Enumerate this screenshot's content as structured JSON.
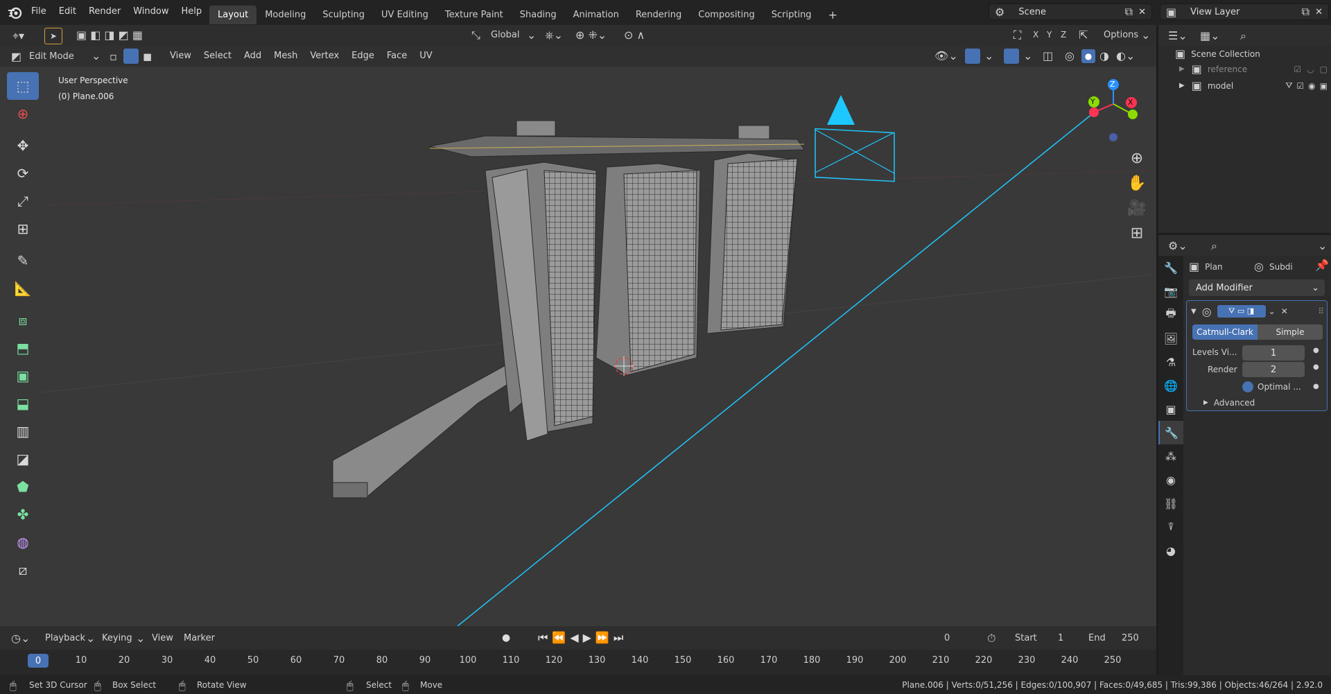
{
  "menu": [
    "File",
    "Edit",
    "Render",
    "Window",
    "Help"
  ],
  "workspaces": [
    "Layout",
    "Modeling",
    "Sculpting",
    "UV Editing",
    "Texture Paint",
    "Shading",
    "Animation",
    "Rendering",
    "Compositing",
    "Scripting"
  ],
  "active_workspace": "Layout",
  "scene": {
    "name": "Scene",
    "view_layer": "View Layer"
  },
  "viewport_header": {
    "transform_orientation": "Global",
    "axis_x": "X",
    "axis_y": "Y",
    "axis_z": "Z",
    "options": "Options"
  },
  "editor_header": {
    "mode": "Edit Mode",
    "menus": [
      "View",
      "Select",
      "Add",
      "Mesh",
      "Vertex",
      "Edge",
      "Face",
      "UV"
    ]
  },
  "overlay_text": {
    "line1": "User Perspective",
    "line2": "(0) Plane.006"
  },
  "gizmo": {
    "z": "Z",
    "y": "Y",
    "x": "X"
  },
  "colors": {
    "accent": "#4772b3",
    "viewport_bg": "#393939",
    "camera": "#1ec8ff",
    "axis_x": "#ff3352",
    "axis_y": "#8bdc00",
    "axis_z": "#2890ff"
  },
  "outliner": {
    "root": "Scene Collection",
    "items": [
      {
        "name": "reference",
        "dim": true
      },
      {
        "name": "model",
        "dim": false
      }
    ]
  },
  "properties": {
    "object_name": "Plan",
    "modifier_name": "Subdi",
    "add_modifier": "Add Modifier",
    "types": [
      "Catmull-Clark",
      "Simple"
    ],
    "selected_type": "Catmull-Clark",
    "levels_viewport_label": "Levels Vi...",
    "levels_viewport": "1",
    "render_label": "Render",
    "render_value": "2",
    "optimal_label": "Optimal ...",
    "advanced": "Advanced"
  },
  "timeline": {
    "menus": [
      "Playback",
      "Keying",
      "View",
      "Marker"
    ],
    "current_frame": "0",
    "frame_display": "0",
    "start_label": "Start",
    "start": "1",
    "end_label": "End",
    "end": "250",
    "ticks": [
      "10",
      "20",
      "30",
      "40",
      "50",
      "60",
      "70",
      "80",
      "90",
      "100",
      "110",
      "120",
      "130",
      "140",
      "150",
      "160",
      "170",
      "180",
      "190",
      "200",
      "210",
      "220",
      "230",
      "240",
      "250"
    ]
  },
  "statusbar": {
    "set_cursor": "Set 3D Cursor",
    "box_select": "Box Select",
    "rotate_view": "Rotate View",
    "select": "Select",
    "move": "Move",
    "stats": "Plane.006 | Verts:0/51,256 | Edges:0/100,907 | Faces:0/49,685 | Tris:99,386 | Objects:46/264 | 2.92.0"
  }
}
